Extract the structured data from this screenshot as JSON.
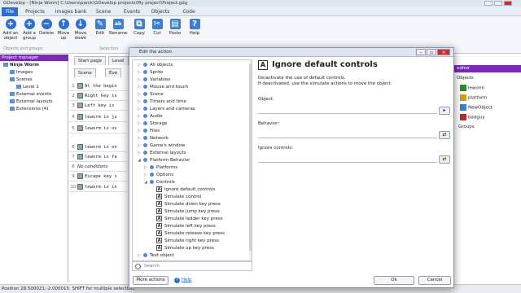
{
  "window": {
    "title": "GDevelop - [Ninja Worm] C:\\Users\\parck\\GDevelop projects\\My project\\Project.gdg"
  },
  "ribbon_tabs": [
    "File",
    "Projects",
    "Images bank",
    "Scene",
    "Events",
    "Objects",
    "Code"
  ],
  "ribbon": {
    "buttons": [
      {
        "l1": "Add an",
        "l2": "object",
        "icon": "add-object-icon"
      },
      {
        "l1": "Add a",
        "l2": "group",
        "icon": "add-group-icon"
      },
      {
        "l1": "Delete",
        "l2": "",
        "icon": "delete-icon"
      },
      {
        "l1": "Move",
        "l2": "up",
        "icon": "move-up-icon"
      },
      {
        "l1": "Move",
        "l2": "down",
        "icon": "move-down-icon"
      },
      {
        "l1": "Edit",
        "l2": "",
        "icon": "edit-icon"
      },
      {
        "l1": "Rename",
        "l2": "",
        "icon": "rename-icon"
      },
      {
        "l1": "Copy",
        "l2": "",
        "icon": "copy-icon"
      },
      {
        "l1": "Cut",
        "l2": "",
        "icon": "cut-icon"
      },
      {
        "l1": "Paste",
        "l2": "",
        "icon": "paste-icon"
      },
      {
        "l1": "Help",
        "l2": "",
        "icon": "help-icon"
      }
    ],
    "group1": "Objects and groups",
    "group2": "Selection"
  },
  "project_manager": {
    "title": "Project manager",
    "items": [
      "Ninja Worm",
      "Images",
      "Scenes",
      "Level 1",
      "External events",
      "External layouts",
      "Extensions (4)"
    ]
  },
  "scene": {
    "tabs": [
      "Start page",
      "Level"
    ],
    "subtabs": [
      "Scene",
      "Eve"
    ],
    "events": [
      {
        "num": "1",
        "text": "At the begin"
      },
      {
        "num": "2",
        "text": "Right key is"
      },
      {
        "num": "3",
        "text": "Left key is"
      },
      {
        "num": "4",
        "text": "leworm is ju"
      },
      {
        "num": "5",
        "text": "leworm is ov"
      },
      {
        "num": "6",
        "text": "leworm is on"
      },
      {
        "num": "7",
        "text": "leworm is fa"
      },
      {
        "num": "8",
        "text": "No conditions"
      },
      {
        "num": "9",
        "text": "Escape key i"
      },
      {
        "num": "10",
        "text": "leworm is in"
      }
    ]
  },
  "dialog": {
    "title": "Edit the action",
    "heading": "Ignore default controls",
    "description": [
      "De/activate the use of default controls.",
      "If deactivated, use the simulate actions to move the object."
    ],
    "fields": [
      "Object:",
      "Behavior:",
      "Ignore controls:"
    ],
    "tree": [
      {
        "label": "All objects",
        "level": 0,
        "exp": "▷",
        "kind": "dot"
      },
      {
        "label": "Sprite",
        "level": 0,
        "exp": "▷",
        "kind": "dot"
      },
      {
        "label": "Variables",
        "level": 0,
        "exp": "▷",
        "kind": "dot"
      },
      {
        "label": "Mouse and touch",
        "level": 0,
        "exp": "▷",
        "kind": "dot"
      },
      {
        "label": "Scene",
        "level": 0,
        "exp": "▷",
        "kind": "dot"
      },
      {
        "label": "Timers and time",
        "level": 0,
        "exp": "▷",
        "kind": "dot"
      },
      {
        "label": "Layers and cameras",
        "level": 0,
        "exp": "▷",
        "kind": "dot"
      },
      {
        "label": "Audio",
        "level": 0,
        "exp": "▷",
        "kind": "dot"
      },
      {
        "label": "Storage",
        "level": 0,
        "exp": "▷",
        "kind": "dot"
      },
      {
        "label": "Files",
        "level": 0,
        "exp": "▷",
        "kind": "dot"
      },
      {
        "label": "Network",
        "level": 0,
        "exp": "▷",
        "kind": "dot"
      },
      {
        "label": "Game's window",
        "level": 0,
        "exp": "▷",
        "kind": "dot"
      },
      {
        "label": "External layouts",
        "level": 0,
        "exp": "▷",
        "kind": "dot"
      },
      {
        "label": "Platform Behavior",
        "level": 0,
        "exp": "◢",
        "kind": "dot"
      },
      {
        "label": "Platforms",
        "level": 1,
        "exp": "▷",
        "kind": "dot"
      },
      {
        "label": "Options",
        "level": 1,
        "exp": "▷",
        "kind": "dot"
      },
      {
        "label": "Controls",
        "level": 1,
        "exp": "◢",
        "kind": "dot"
      },
      {
        "label": "Ignore default controls",
        "level": 2,
        "exp": "",
        "kind": "action"
      },
      {
        "label": "Simulate control",
        "level": 2,
        "exp": "",
        "kind": "action"
      },
      {
        "label": "Simulate down key press",
        "level": 2,
        "exp": "",
        "kind": "action"
      },
      {
        "label": "Simulate jump key press",
        "level": 2,
        "exp": "",
        "kind": "action"
      },
      {
        "label": "Simulate ladder key press",
        "level": 2,
        "exp": "",
        "kind": "action"
      },
      {
        "label": "Simulate left key press",
        "level": 2,
        "exp": "",
        "kind": "action"
      },
      {
        "label": "Simulate release key press",
        "level": 2,
        "exp": "",
        "kind": "action"
      },
      {
        "label": "Simulate right key press",
        "level": 2,
        "exp": "",
        "kind": "action"
      },
      {
        "label": "Simulate up key press",
        "level": 2,
        "exp": "",
        "kind": "action"
      },
      {
        "label": "Text object",
        "level": 0,
        "exp": "▷",
        "kind": "dot"
      }
    ],
    "search_placeholder": "Search",
    "more_actions": "More actions",
    "help": "Help",
    "ok": "Ok",
    "cancel": "Cancel"
  },
  "objects_panel": {
    "title": "editor",
    "section": "Objects",
    "items": [
      "leworm",
      "platform",
      "NewObject",
      "badguy"
    ],
    "groups": "Groups"
  },
  "status": {
    "text": "Position 28.500021;-2.000015. SHIFT for multiple selection,"
  }
}
